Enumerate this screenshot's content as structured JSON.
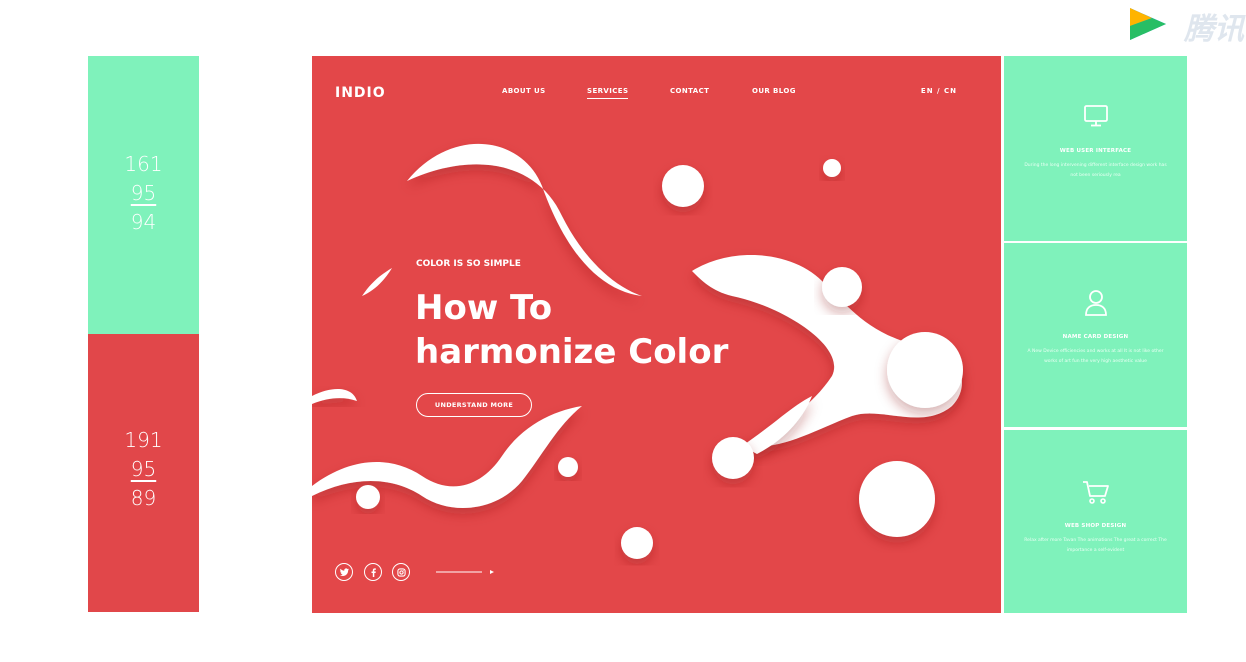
{
  "swatches": {
    "green": {
      "color": "#7ff2bb",
      "rgb": [
        "161",
        "95",
        "94"
      ]
    },
    "red": {
      "color": "#e1474a",
      "rgb": [
        "191",
        "95",
        "89"
      ]
    }
  },
  "hero": {
    "background": "#e34749",
    "logo": "INDIO",
    "nav": [
      "ABOUT US",
      "SERVICES",
      "CONTACT",
      "OUR BLOG"
    ],
    "active_nav": "SERVICES",
    "language": "EN / CN",
    "eyebrow": "COLOR IS SO SIMPLE",
    "headline_line1": "How To",
    "headline_line2": "harmonize Color",
    "cta": "UNDERSTAND MORE",
    "social_icons": [
      "twitter-icon",
      "facebook-icon",
      "instagram-icon"
    ]
  },
  "services": [
    {
      "icon": "monitor-icon",
      "title": "WEB USER INTERFACE",
      "description": "During the long intervening different interface design work has not been seriously rea"
    },
    {
      "icon": "user-icon",
      "title": "NAME CARD DESIGN",
      "description": "A New Device efficiencies and works at all It is not like other works of art fun the very high aesthetic value"
    },
    {
      "icon": "cart-icon",
      "title": "WEB SHOP DESIGN",
      "description": "Relax after more Tavan The animations The great a correct The importance a self-evident"
    }
  ],
  "accent_green": "#7ff2bb",
  "watermark": {
    "text": "腾讯",
    "icon": "play-logo-icon"
  }
}
